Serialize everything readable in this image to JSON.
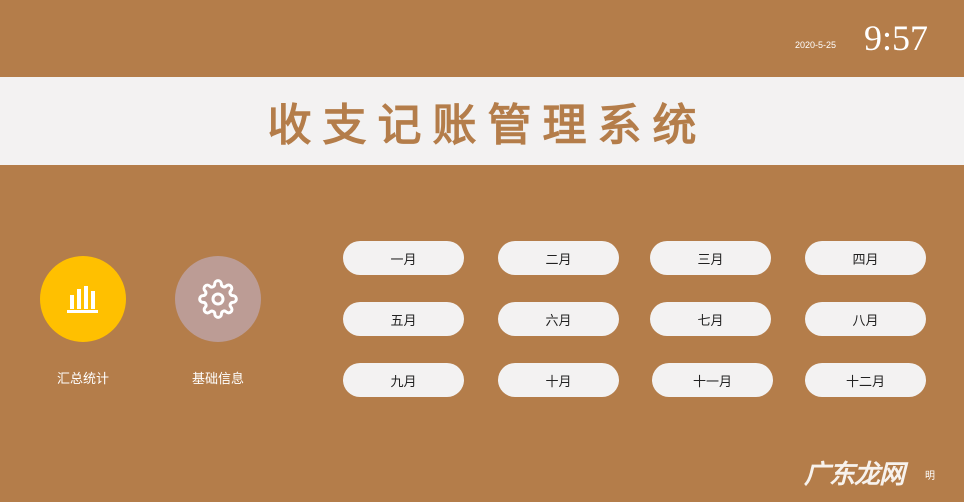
{
  "header": {
    "date": "2020-5-25",
    "time": "9:57"
  },
  "title": "收支记账管理系统",
  "features": [
    {
      "label": "汇总统计",
      "icon": "bar-chart-icon",
      "color": "#ffc000"
    },
    {
      "label": "基础信息",
      "icon": "gear-icon",
      "color": "#bc9c95"
    }
  ],
  "months": [
    "一月",
    "二月",
    "三月",
    "四月",
    "五月",
    "六月",
    "七月",
    "八月",
    "九月",
    "十月",
    "十一月",
    "十二月"
  ],
  "watermark": {
    "logo": "广东龙网",
    "tail": "明"
  },
  "colors": {
    "background": "#b47d4a",
    "band": "#f3f2f2",
    "title": "#b47d4a"
  }
}
